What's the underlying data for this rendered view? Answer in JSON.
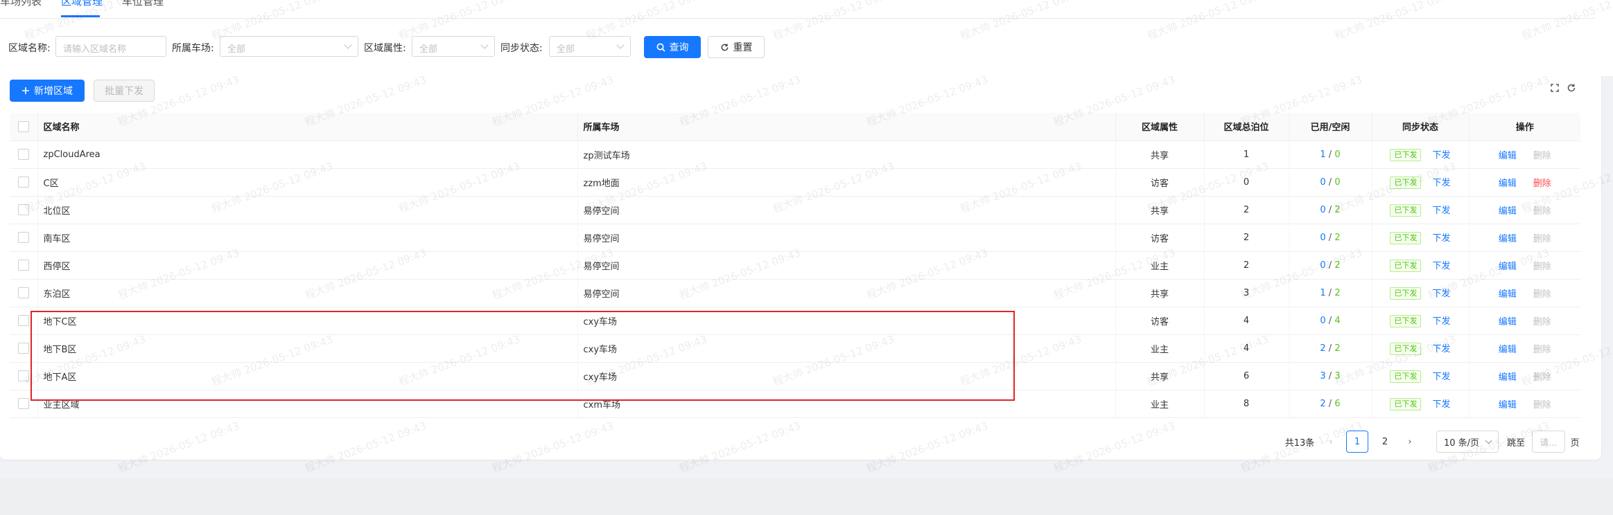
{
  "tabs": [
    {
      "label": "车场列表"
    },
    {
      "label": "区域管理"
    },
    {
      "label": "车位管理"
    }
  ],
  "filters": {
    "area_name_label": "区域名称:",
    "area_name_placeholder": "请输入区域名称",
    "parking_label": "所属车场:",
    "parking_value": "全部",
    "attr_label": "区域属性:",
    "attr_value": "全部",
    "sync_label": "同步状态:",
    "sync_value": "全部",
    "query_label": "查询",
    "reset_label": "重置"
  },
  "toolbar": {
    "add_label": "新增区域",
    "batch_label": "批量下发"
  },
  "table": {
    "headers": [
      "区域名称",
      "所属车场",
      "区域属性",
      "区域总泊位",
      "已用/空闲",
      "同步状态",
      "操作"
    ],
    "rows": [
      {
        "name": "zpCloudArea",
        "parking": "zp测试车场",
        "attr": "共享",
        "total": "1",
        "used": "1",
        "free": "0",
        "status": "已下发",
        "action": "下发",
        "edit": "编辑",
        "delete": "删除",
        "delete_enabled": false
      },
      {
        "name": "C区",
        "parking": "zzm地面",
        "attr": "访客",
        "total": "0",
        "used": "0",
        "free": "0",
        "status": "已下发",
        "action": "下发",
        "edit": "编辑",
        "delete": "删除",
        "delete_enabled": true
      },
      {
        "name": "北位区",
        "parking": "易停空间",
        "attr": "共享",
        "total": "2",
        "used": "0",
        "free": "2",
        "status": "已下发",
        "action": "下发",
        "edit": "编辑",
        "delete": "删除",
        "delete_enabled": false
      },
      {
        "name": "南车区",
        "parking": "易停空间",
        "attr": "访客",
        "total": "2",
        "used": "0",
        "free": "2",
        "status": "已下发",
        "action": "下发",
        "edit": "编辑",
        "delete": "删除",
        "delete_enabled": false
      },
      {
        "name": "西停区",
        "parking": "易停空间",
        "attr": "业主",
        "total": "2",
        "used": "0",
        "free": "2",
        "status": "已下发",
        "action": "下发",
        "edit": "编辑",
        "delete": "删除",
        "delete_enabled": false
      },
      {
        "name": "东泊区",
        "parking": "易停空间",
        "attr": "共享",
        "total": "3",
        "used": "1",
        "free": "2",
        "status": "已下发",
        "action": "下发",
        "edit": "编辑",
        "delete": "删除",
        "delete_enabled": false
      },
      {
        "name": "地下C区",
        "parking": "cxy车场",
        "attr": "访客",
        "total": "4",
        "used": "0",
        "free": "4",
        "status": "已下发",
        "action": "下发",
        "edit": "编辑",
        "delete": "删除",
        "delete_enabled": false
      },
      {
        "name": "地下B区",
        "parking": "cxy车场",
        "attr": "业主",
        "total": "4",
        "used": "2",
        "free": "2",
        "status": "已下发",
        "action": "下发",
        "edit": "编辑",
        "delete": "删除",
        "delete_enabled": false
      },
      {
        "name": "地下A区",
        "parking": "cxy车场",
        "attr": "共享",
        "total": "6",
        "used": "3",
        "free": "3",
        "status": "已下发",
        "action": "下发",
        "edit": "编辑",
        "delete": "删除",
        "delete_enabled": false
      },
      {
        "name": "业主区域",
        "parking": "cxm车场",
        "attr": "业主",
        "total": "8",
        "used": "2",
        "free": "6",
        "status": "已下发",
        "action": "下发",
        "edit": "编辑",
        "delete": "删除",
        "delete_enabled": false
      }
    ]
  },
  "pagination": {
    "total_text": "共13条",
    "pages": [
      "1",
      "2"
    ],
    "current_page": "1",
    "page_size": "10 条/页",
    "jump_label": "跳至",
    "jump_placeholder": "请...",
    "page_suffix": "页"
  },
  "watermark": "程大帅 2026-05-12 09:43",
  "colors": {
    "primary": "#1677ff",
    "success": "#52c41a",
    "danger": "#ff4d4f",
    "highlight_border": "#e02424"
  }
}
